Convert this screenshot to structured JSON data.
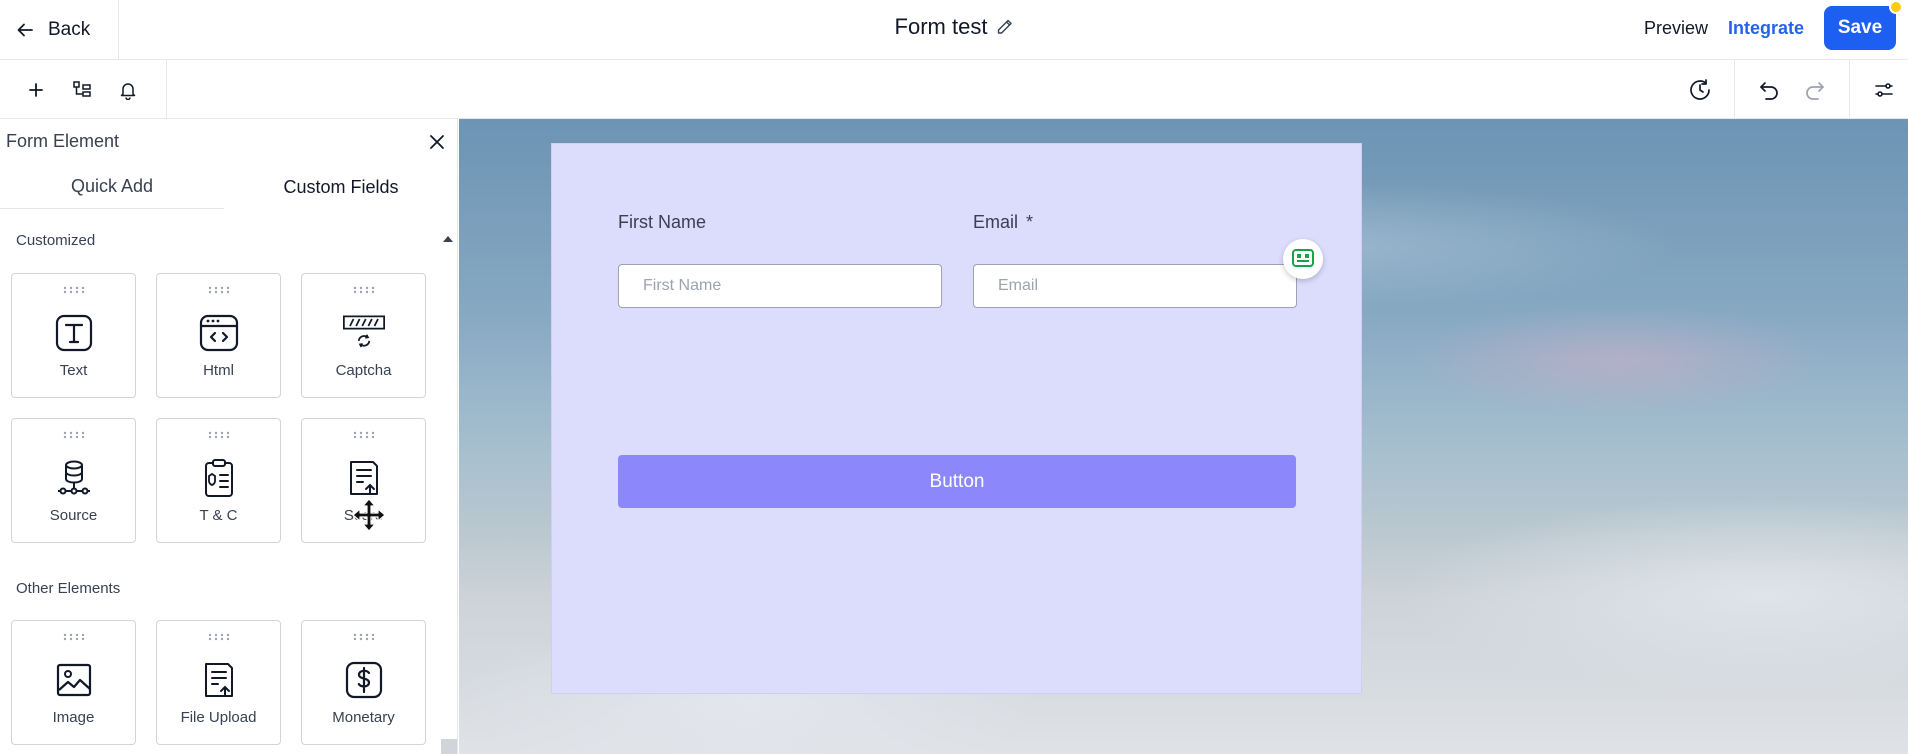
{
  "header": {
    "back_label": "Back",
    "title": "Form test",
    "preview_label": "Preview",
    "integrate_label": "Integrate",
    "save_label": "Save"
  },
  "panel": {
    "title": "Form Element",
    "tabs": [
      {
        "label": "Quick Add",
        "active": false
      },
      {
        "label": "Custom Fields",
        "active": true
      }
    ],
    "sections": [
      {
        "label": "Customized",
        "items": [
          {
            "label": "Text",
            "icon": "text-icon"
          },
          {
            "label": "Html",
            "icon": "html-icon"
          },
          {
            "label": "Captcha",
            "icon": "captcha-icon"
          },
          {
            "label": "Source",
            "icon": "source-icon"
          },
          {
            "label": "T & C",
            "icon": "terms-icon"
          },
          {
            "label": "Score",
            "icon": "score-icon"
          }
        ]
      },
      {
        "label": "Other Elements",
        "items": [
          {
            "label": "Image",
            "icon": "image-icon"
          },
          {
            "label": "File Upload",
            "icon": "file-upload-icon"
          },
          {
            "label": "Monetary",
            "icon": "monetary-icon"
          }
        ]
      }
    ]
  },
  "form": {
    "fields": [
      {
        "label": "First Name",
        "placeholder": "First Name",
        "required": false
      },
      {
        "label": "Email",
        "placeholder": "Email",
        "required": true,
        "required_marker": "*"
      }
    ],
    "button_label": "Button"
  },
  "colors": {
    "accent": "#1d5ff0",
    "link": "#2563eb",
    "form_background": "#dcdcfc",
    "form_button": "#8c87fa",
    "notification_dot": "#facc15"
  }
}
